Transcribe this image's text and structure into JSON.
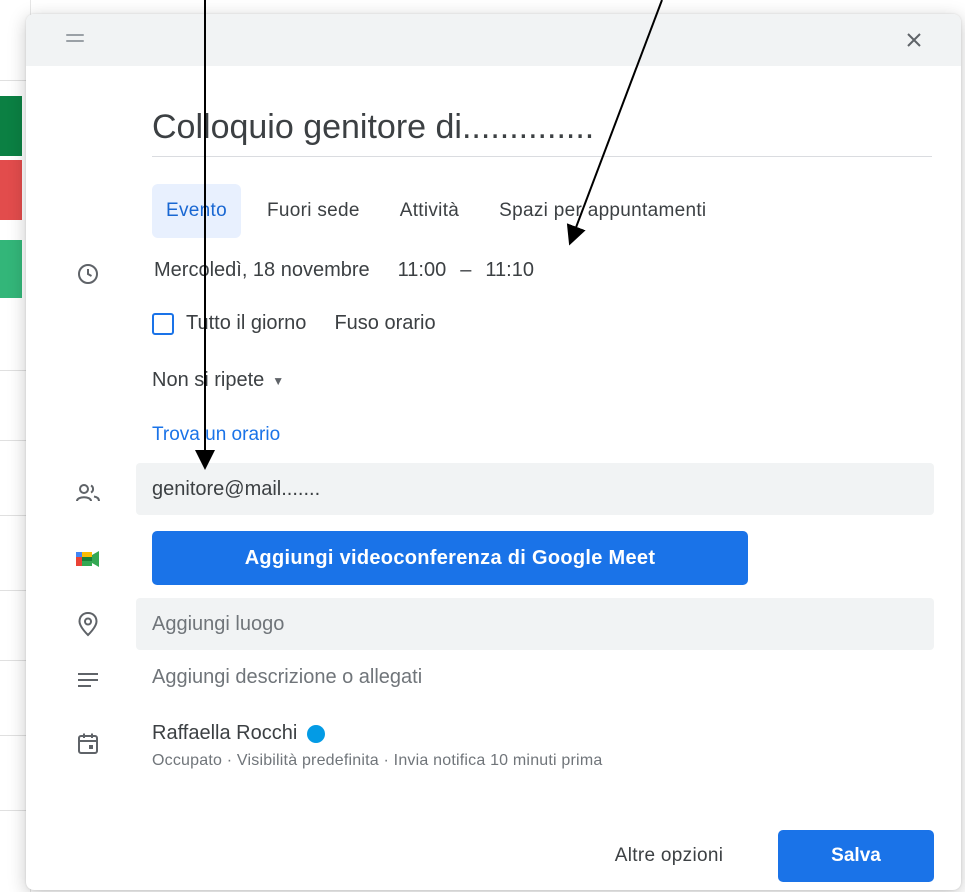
{
  "dialog": {
    "title": "Colloquio genitore di..............",
    "tabs": [
      {
        "label": "Evento",
        "active": true
      },
      {
        "label": "Fuori sede",
        "active": false
      },
      {
        "label": "Attività",
        "active": false
      },
      {
        "label": "Spazi per appuntamenti",
        "active": false
      }
    ],
    "date": "Mercoledì, 18 novembre",
    "start_time": "11:00",
    "time_separator": "–",
    "end_time": "11:10",
    "all_day_label": "Tutto il giorno",
    "all_day_checked": false,
    "timezone_label": "Fuso orario",
    "repeat_label": "Non si ripete",
    "find_time_label": "Trova un orario",
    "guests_value": "genitore@mail.......",
    "meet_button_label": "Aggiungi videoconferenza di Google Meet",
    "location_placeholder": "Aggiungi luogo",
    "description_placeholder": "Aggiungi descrizione o allegati",
    "calendar_owner": "Raffaella Rocchi",
    "calendar_color": "#039be5",
    "calendar_meta": "Occupato · Visibilità predefinita · Invia notifica 10 minuti prima",
    "more_options_label": "Altre opzioni",
    "save_label": "Salva"
  },
  "icons": {
    "close": "close-icon",
    "drag": "drag-handle-icon",
    "time": "clock-icon",
    "guests": "people-icon",
    "meet": "google-meet-icon",
    "location": "location-pin-icon",
    "description": "notes-icon",
    "calendar": "calendar-icon"
  },
  "colors": {
    "accent": "#1a73e8",
    "tab_active_bg": "#e8f0fe",
    "field_bg": "#f1f3f4"
  }
}
